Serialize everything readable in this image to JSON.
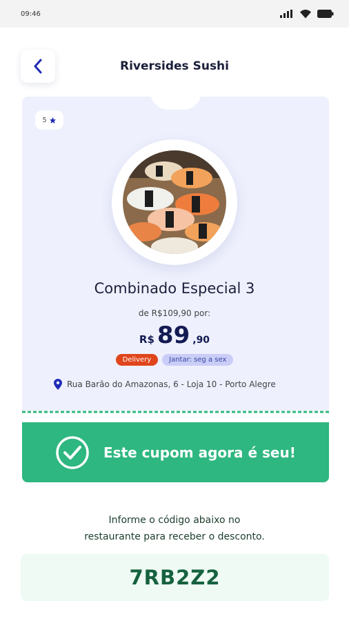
{
  "status_bar": {
    "time": "09:46",
    "icons": [
      "signal-icon",
      "wifi-icon",
      "battery-icon"
    ]
  },
  "header": {
    "back_icon": "chevron-left-icon",
    "title": "Riversides Sushi"
  },
  "card": {
    "rating": "5",
    "rating_icon": "star-icon",
    "image_alt": "sushi-platter",
    "product_name": "Combinado Especial 3",
    "old_price": "de R$109,90 por:",
    "price_currency": "R$",
    "price_integer": "89",
    "price_cents": ",90",
    "tags": [
      {
        "label": "Delivery",
        "color": "#e0451b"
      },
      {
        "label": "Jantar: seg a sex",
        "color": "#c9cdf7"
      }
    ],
    "address_icon": "location-pin-icon",
    "address": "Rua Barão do Amazonas, 6 - Loja 10 - Porto Alegre"
  },
  "banner": {
    "icon": "check-circle-icon",
    "text": "Este cupom agora é seu!",
    "color": "#2eb780"
  },
  "instructions": {
    "line1": "Informe o código abaixo no",
    "line2": "restaurante para receber o desconto."
  },
  "coupon_code": "7RB2Z2",
  "colors": {
    "accent": "#1f2bb5",
    "card_bg": "#eef0fd",
    "success": "#2eb780",
    "code_text": "#16613f"
  }
}
